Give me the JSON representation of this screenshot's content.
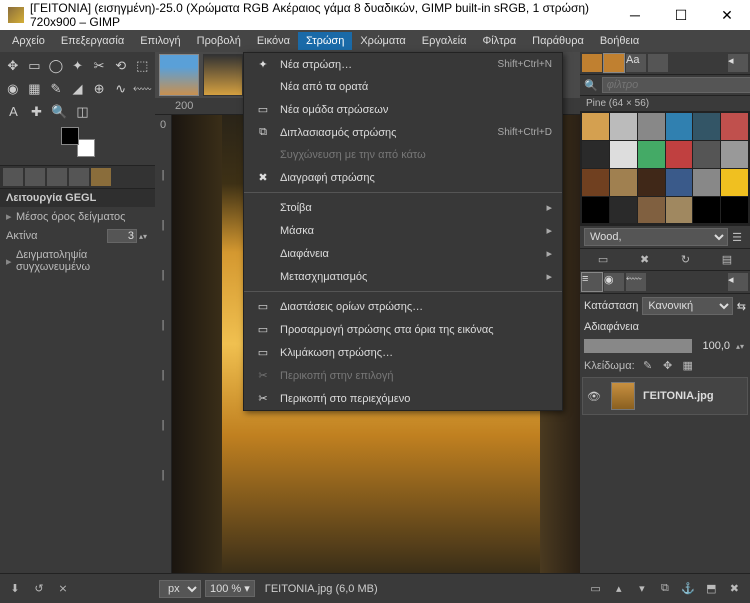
{
  "title": "[ΓΕΙΤΟΝΙΑ] (εισηγμένη)-25.0 (Χρώματα RGB Ακέραιος γάμα 8 δυαδικών, GIMP built-in sRGB, 1 στρώση) 720x900 – GIMP",
  "menubar": [
    "Αρχείο",
    "Επεξεργασία",
    "Επιλογή",
    "Προβολή",
    "Εικόνα",
    "Στρώση",
    "Χρώματα",
    "Εργαλεία",
    "Φίλτρα",
    "Παράθυρα",
    "Βοήθεια"
  ],
  "active_menu_index": 5,
  "dropdown": [
    {
      "type": "item",
      "icon": "✦",
      "label": "Νέα στρώση…",
      "accel": "Shift+Ctrl+N"
    },
    {
      "type": "item",
      "icon": "",
      "label": "Νέα από τα ορατά"
    },
    {
      "type": "item",
      "icon": "▭",
      "label": "Νέα ομάδα στρώσεων"
    },
    {
      "type": "item",
      "icon": "⧉",
      "label": "Διπλασιασμός στρώσης",
      "accel": "Shift+Ctrl+D"
    },
    {
      "type": "item",
      "icon": "",
      "label": "Συγχώνευση με την από κάτω",
      "disabled": true
    },
    {
      "type": "item",
      "icon": "✖",
      "label": "Διαγραφή στρώσης"
    },
    {
      "type": "sep"
    },
    {
      "type": "sub",
      "label": "Στοίβα"
    },
    {
      "type": "sub",
      "label": "Μάσκα"
    },
    {
      "type": "sub",
      "label": "Διαφάνεια"
    },
    {
      "type": "sub",
      "label": "Μετασχηματισμός"
    },
    {
      "type": "sep"
    },
    {
      "type": "item",
      "icon": "▭",
      "label": "Διαστάσεις ορίων στρώσης…"
    },
    {
      "type": "item",
      "icon": "▭",
      "label": "Προσαρμογή στρώσης στα όρια της εικόνας"
    },
    {
      "type": "item",
      "icon": "▭",
      "label": "Κλιμάκωση στρώσης…"
    },
    {
      "type": "item",
      "icon": "✂",
      "label": "Περικοπή στην επιλογή",
      "disabled": true
    },
    {
      "type": "item",
      "icon": "✂",
      "label": "Περικοπή στο περιεχόμενο"
    }
  ],
  "tool_options": {
    "header": "Λειτουργία GEGL",
    "row1": "Μέσος όρος δείγματος",
    "radius_label": "Ακτίνα",
    "radius_value": "3",
    "row3": "Δειγματοληψία συγχωνευμένω"
  },
  "ruler_h": [
    "200"
  ],
  "ruler_v": [
    "0",
    "|",
    "|",
    "|",
    "|",
    "|",
    "|",
    "|"
  ],
  "patterns": {
    "search_placeholder": "φίλτρο",
    "title": "Pine (64 × 56)",
    "footer_value": "Wood,",
    "colors": [
      "#d4a050",
      "#bbb",
      "#888",
      "#3080b0",
      "#356",
      "#c0504d",
      "#2a2a2a",
      "#ddd",
      "#4a6",
      "#c04040",
      "#555",
      "#999",
      "#704020",
      "#a08050",
      "#402818",
      "#3a5a8a",
      "#888",
      "#f0c020",
      "#000",
      "#2a2a2a",
      "#806040",
      "#a08860",
      "#000",
      "#000"
    ]
  },
  "layers": {
    "mode_label": "Κατάσταση",
    "mode_value": "Κανονική",
    "opacity_label": "Αδιαφάνεια",
    "opacity_value": "100,0",
    "lock_label": "Κλείδωμα:",
    "layer_name": "ΓΕΙΤΟΝΙΑ.jpg"
  },
  "statusbar": {
    "unit": "px",
    "zoom": "100 %",
    "info": "ΓΕΙΤΟΝΙΑ.jpg (6,0 MB)"
  }
}
